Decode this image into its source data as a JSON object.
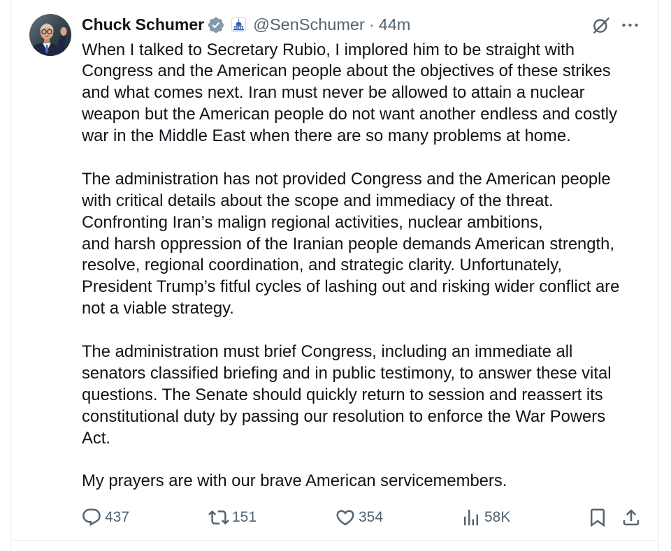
{
  "tweet": {
    "author": {
      "name": "Chuck Schumer",
      "handle": "@SenSchumer",
      "separator": "·",
      "time": "44m",
      "verified_icon": "verified-badge-icon",
      "affiliate_icon": "capitol-icon"
    },
    "header_icons": {
      "grok": "grok-icon",
      "more": "more-icon"
    },
    "paragraphs": [
      {
        "lines": [
          "When I talked to Secretary Rubio, I implored him to be straight with",
          "Congress and the American people about the objectives of these strikes",
          "and what comes next. Iran must never be allowed to attain a nuclear",
          "weapon but the American people do not want another endless and costly",
          "war in the Middle East when there are so many problems at home."
        ]
      },
      {
        "lines": [
          "The administration has not provided Congress and the American people",
          "with critical details about the scope and immediacy of the threat.",
          "Confronting Iran’s malign regional activities, nuclear ambitions,",
          "and harsh oppression of the Iranian people demands American strength,",
          "resolve, regional coordination, and strategic clarity. Unfortunately,",
          "President Trump’s fitful cycles of lashing out and risking wider conflict are",
          "not a viable strategy."
        ]
      },
      {
        "lines": [
          "The administration must brief Congress, including an immediate all",
          "senators classified briefing and in public testimony, to answer these vital",
          "questions. The Senate should quickly return to session and reassert its",
          "constitutional duty by passing our resolution to enforce the War Powers",
          "Act."
        ]
      },
      {
        "lines": [
          "My prayers are with our brave American servicemembers."
        ]
      }
    ],
    "actions": {
      "reply": {
        "icon": "reply-icon",
        "count": "437"
      },
      "repost": {
        "icon": "repost-icon",
        "count": "151"
      },
      "like": {
        "icon": "like-icon",
        "count": "354"
      },
      "views": {
        "icon": "views-icon",
        "count": "58K"
      },
      "bookmark": {
        "icon": "bookmark-icon"
      },
      "share": {
        "icon": "share-icon"
      }
    }
  },
  "colors": {
    "background": "#ffffff",
    "text_primary": "#0f1419",
    "text_secondary": "#536471",
    "border": "#e6ecf0",
    "verified_badge": "#829aab",
    "affiliate_badge": "#2c56b3"
  }
}
